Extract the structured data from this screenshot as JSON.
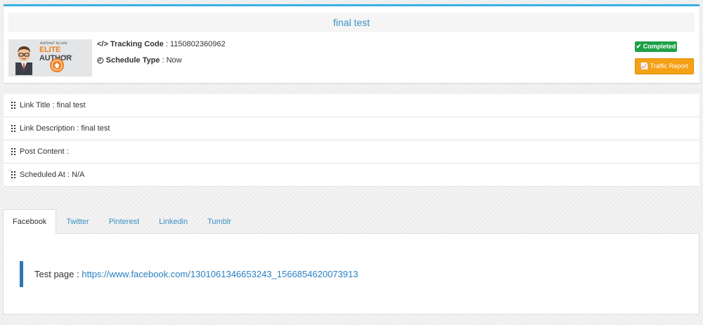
{
  "campaign": {
    "title": "final test",
    "author_badge": {
      "small_text": "AutOmaT by exlo",
      "elite_word": "ELITE",
      "author_word": "AUTHOR",
      "tiny_text": "$75000+"
    },
    "tracking_label": "Tracking Code",
    "tracking_value": ": 1150802360962",
    "schedule_label": "Schedule Type",
    "schedule_value": ": Now",
    "status": "Completed",
    "traffic_report_label": "Traffic Report",
    "colors": {
      "accent": "#3ab0e2",
      "status_green": "#1fa049",
      "traffic_orange": "#f5a015",
      "link_blue": "#3a8fc7"
    }
  },
  "details": [
    {
      "text": "Link Title : final test"
    },
    {
      "text": "Link Description : final test"
    },
    {
      "text": "Post Content :"
    },
    {
      "text": "Scheduled At : N/A"
    }
  ],
  "tabs": [
    {
      "label": "Facebook",
      "active": true
    },
    {
      "label": "Twitter",
      "active": false
    },
    {
      "label": "Pinterest",
      "active": false
    },
    {
      "label": "Linkedin",
      "active": false
    },
    {
      "label": "Tumblr",
      "active": false
    }
  ],
  "panel": {
    "label": "Test page :",
    "link": "https://www.facebook.com/1301061346653243_1566854620073913"
  }
}
